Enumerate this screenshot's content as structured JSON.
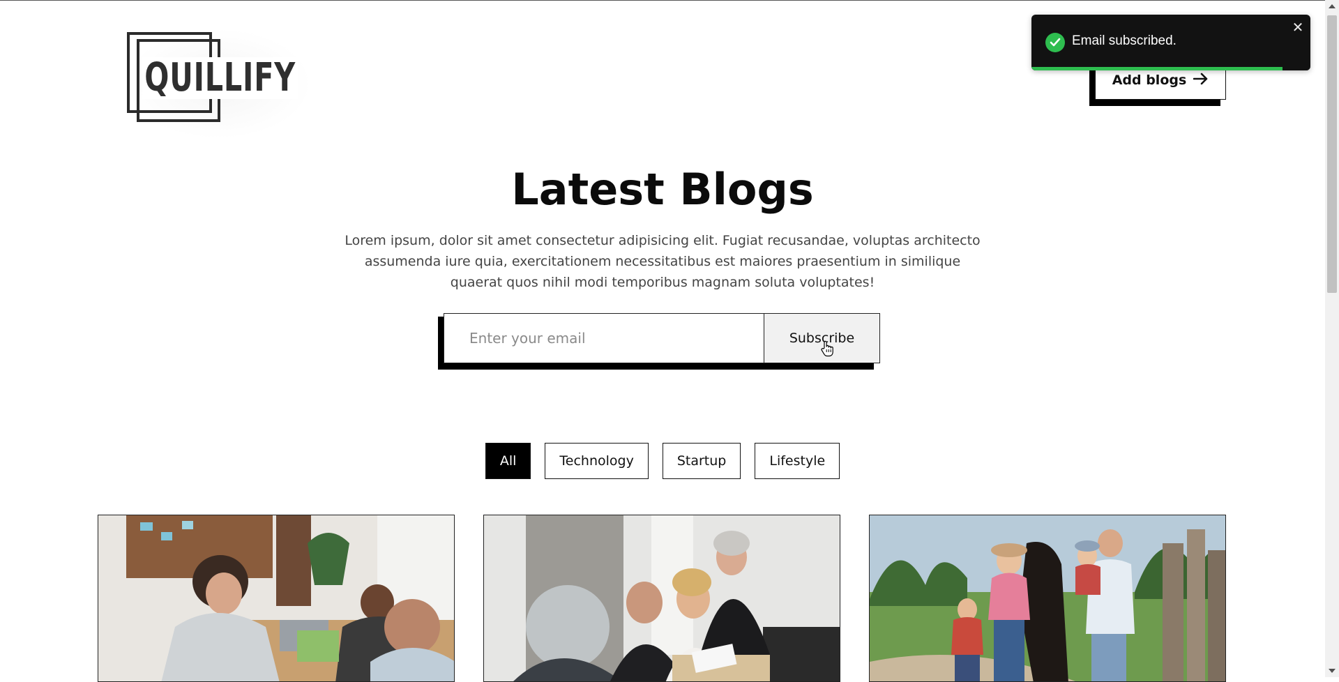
{
  "brand": {
    "logo_text": "QUILLIFY"
  },
  "header": {
    "add_blogs_label": "Add blogs",
    "add_blogs_icon": "arrow-right-icon"
  },
  "toast": {
    "message": "Email subscribed.",
    "icon": "check-circle-icon",
    "close_glyph": "✕",
    "progress": 0.9,
    "accent": "#2ebd4f"
  },
  "hero": {
    "title": "Latest Blogs",
    "description": "Lorem ipsum, dolor sit amet consectetur adipisicing elit. Fugiat recusandae, voluptas architecto assumenda iure quia, exercitationem necessitatibus est maiores praesentium in similique quaerat quos nihil modi temporibus magnam soluta voluptates!"
  },
  "subscribe": {
    "placeholder": "Enter your email",
    "value": "",
    "button_label": "Subscribe"
  },
  "filters": [
    {
      "label": "All",
      "active": true
    },
    {
      "label": "Technology",
      "active": false
    },
    {
      "label": "Startup",
      "active": false
    },
    {
      "label": "Lifestyle",
      "active": false
    }
  ],
  "cards": [
    {
      "image": "office-meeting-photo"
    },
    {
      "image": "business-team-photo"
    },
    {
      "image": "family-with-horse-photo"
    }
  ]
}
